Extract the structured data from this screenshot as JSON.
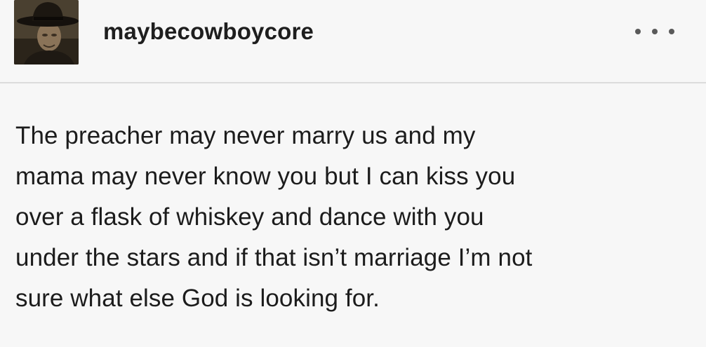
{
  "post": {
    "author": {
      "username": "maybecowboycore",
      "avatar": "cowboy-hat-avatar"
    },
    "menu_icon": "more-dots-icon",
    "body_lines": [
      "The preacher may never marry us and my",
      "mama may never know you but I can kiss you",
      "over a flask of whiskey and dance with you",
      "under the stars and if that isn’t marriage I’m not",
      "sure what else God is looking for."
    ]
  },
  "colors": {
    "background": "#f7f7f7",
    "text": "#1c1c1c",
    "divider": "#dcdcdc"
  }
}
